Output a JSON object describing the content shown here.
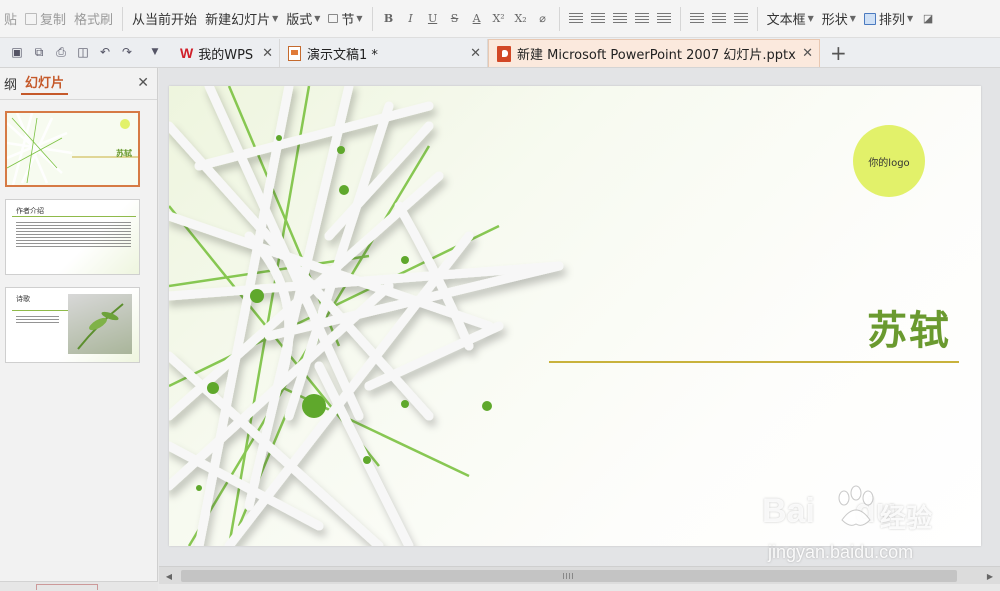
{
  "ribbon": {
    "paste": "贴",
    "copy": "复制",
    "format_painter": "格式刷",
    "from_current": "从当前开始",
    "new_slide": "新建幻灯片",
    "layout": "版式",
    "section": "节",
    "textbox": "文本框",
    "shape": "形状",
    "arrange": "排列",
    "bold": "B",
    "italic": "I",
    "underline": "U",
    "strike": "S",
    "font_color": "A",
    "superscript": "X²",
    "subscript": "X₂"
  },
  "tabs": [
    {
      "label": "我的WPS",
      "icon": "wps-logo-icon"
    },
    {
      "label": "演示文稿1 *",
      "icon": "document-icon"
    },
    {
      "label": "新建 Microsoft PowerPoint 2007 幻灯片.pptx",
      "icon": "ppt-file-icon",
      "active": true
    }
  ],
  "left_panel": {
    "outline_tab": "纲",
    "slides_tab": "幻灯片",
    "thumbs": [
      {
        "title": "苏轼",
        "logo": "logo"
      },
      {
        "title": "作者介绍"
      },
      {
        "title": "诗歌"
      }
    ]
  },
  "slide": {
    "logo_text": "你的logo",
    "title": "苏轼"
  },
  "watermark": {
    "brand": "Bai",
    "brand2": "du",
    "cn": "经验",
    "url": "jingyan.baidu.com"
  },
  "colors": {
    "accent": "#c5592a",
    "title_green": "#6a9a2f",
    "logo_yellow": "#e2f16a",
    "rule": "#c8b23c"
  }
}
